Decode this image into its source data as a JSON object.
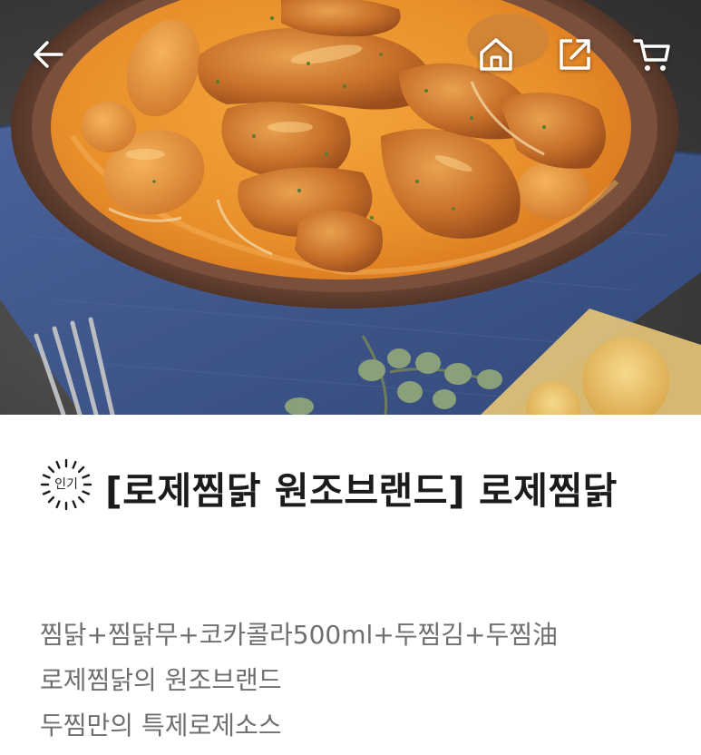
{
  "header": {
    "back_icon": "arrow-left-icon",
    "home_icon": "home-icon",
    "share_icon": "share-icon",
    "cart_icon": "cart-icon"
  },
  "product": {
    "badge": "인기",
    "title": "[로제찜닭 원조브랜드] 로제찜닭",
    "description_lines": [
      "찜닭+찜닭무+코카콜라500ml+두찜김+두찜油",
      "로제찜닭의 원조브랜드",
      "두찜만의 특제로제소스"
    ]
  },
  "colors": {
    "title": "#1b1b1b",
    "description": "#6f6f6f",
    "sauce": "#e8902e",
    "plate": "#5a3a2c",
    "napkin": "#3d5683"
  }
}
